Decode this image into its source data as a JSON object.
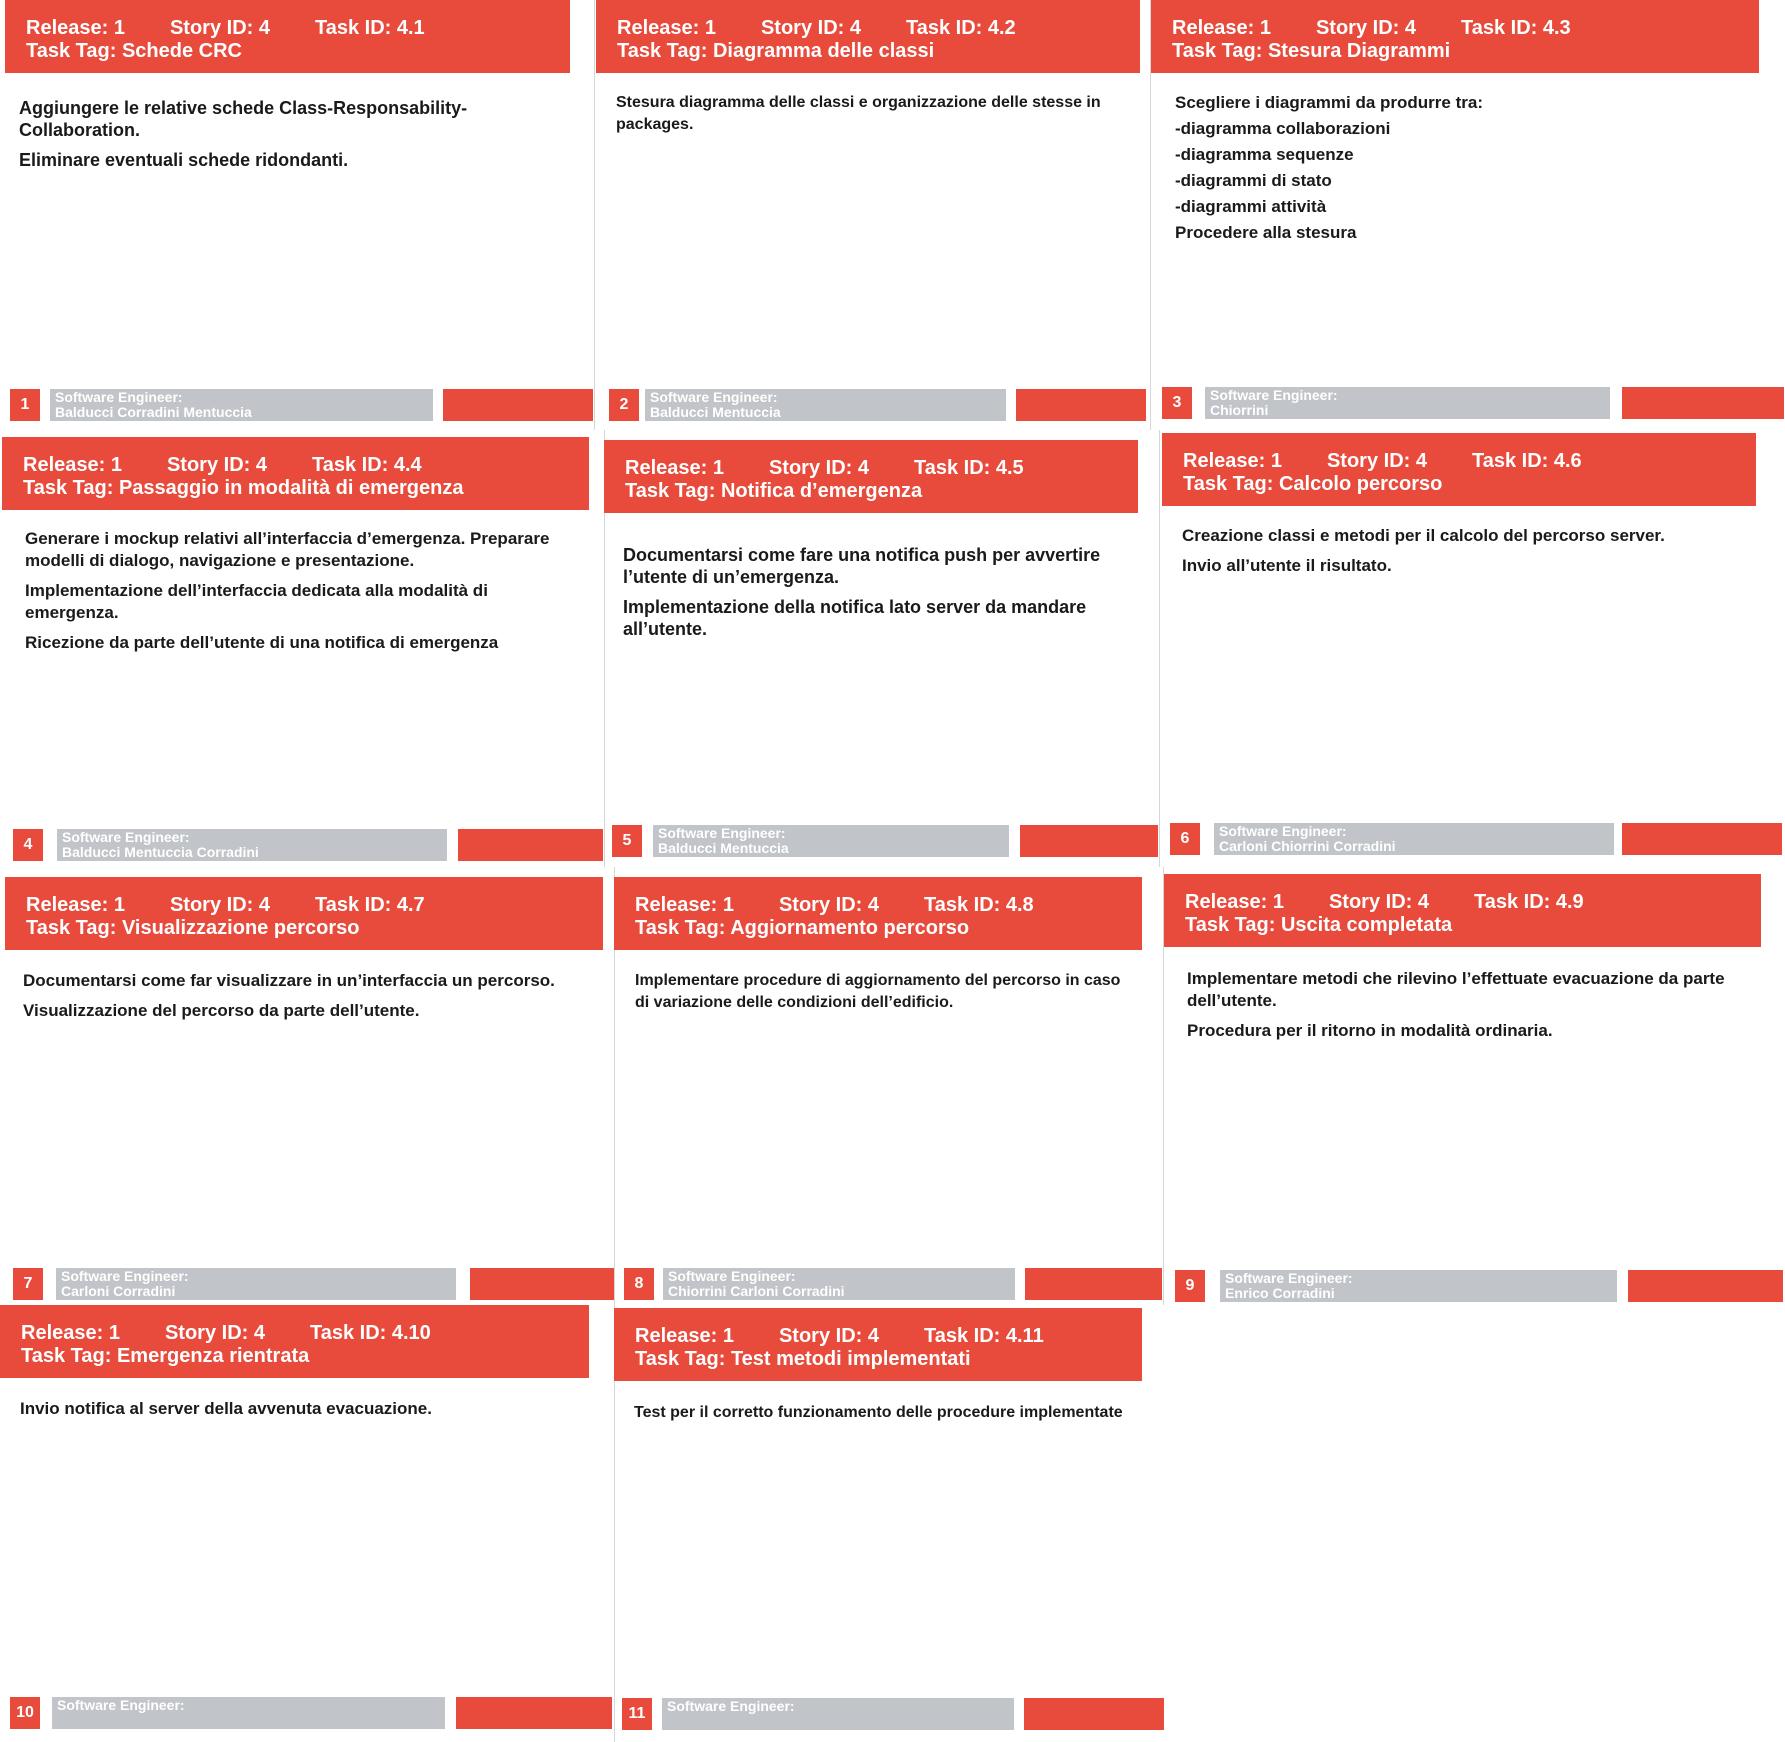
{
  "colors": {
    "accent": "#e84a3c",
    "footer_gray": "#c1c4c8",
    "text": "#1a1a1a"
  },
  "cards": [
    {
      "release": "Release: 1",
      "story": "Story ID: 4",
      "task": "Task ID: 4.1",
      "tag": "Task Tag: Schede CRC",
      "body": [
        "Aggiungere le relative schede Class-Responsability-Collaboration.",
        "Eliminare eventuali schede ridondanti."
      ],
      "number": "1",
      "engineer_label": "Software Engineer:",
      "engineers": "Balducci Corradini Mentuccia"
    },
    {
      "release": "Release: 1",
      "story": "Story ID: 4",
      "task": "Task ID: 4.2",
      "tag": "Task Tag: Diagramma delle classi",
      "body": [
        "Stesura diagramma delle classi e organizzazione delle stesse in packages."
      ],
      "number": "2",
      "engineer_label": "Software Engineer:",
      "engineers": "Balducci Mentuccia"
    },
    {
      "release": "Release: 1",
      "story": "Story ID: 4",
      "task": "Task ID: 4.3",
      "tag": "Task Tag: Stesura Diagrammi",
      "body": [
        "Scegliere i diagrammi da produrre tra:",
        "-diagramma collaborazioni",
        "-diagramma sequenze",
        "-diagrammi di stato",
        "-diagrammi attività",
        "Procedere alla stesura"
      ],
      "number": "3",
      "engineer_label": "Software Engineer:",
      "engineers": "Chiorrini"
    },
    {
      "release": "Release: 1",
      "story": "Story ID: 4",
      "task": "Task ID: 4.4",
      "tag": "Task Tag: Passaggio in modalità di emergenza",
      "body": [
        "Generare i  mockup relativi all’interfaccia d’emergenza. Preparare modelli di dialogo, navigazione e presentazione.",
        "Implementazione dell’interfaccia dedicata alla modalità di emergenza.",
        "Ricezione da parte dell’utente di una notifica di emergenza"
      ],
      "number": "4",
      "engineer_label": "Software Engineer:",
      "engineers": "Balducci Mentuccia Corradini"
    },
    {
      "release": "Release: 1",
      "story": "Story ID: 4",
      "task": "Task ID: 4.5",
      "tag": "Task Tag: Notifica d’emergenza",
      "body": [
        "Documentarsi come fare una notifica push per avvertire l’utente di un’emergenza.",
        "Implementazione della notifica lato server da mandare all’utente."
      ],
      "number": "5",
      "engineer_label": "Software Engineer:",
      "engineers": "Balducci Mentuccia"
    },
    {
      "release": "Release: 1",
      "story": "Story ID: 4",
      "task": "Task ID: 4.6",
      "tag": "Task Tag: Calcolo percorso",
      "body": [
        "Creazione classi e metodi per il calcolo del percorso server.",
        "Invio all’utente il risultato."
      ],
      "number": "6",
      "engineer_label": "Software Engineer:",
      "engineers": "Carloni Chiorrini Corradini"
    },
    {
      "release": "Release: 1",
      "story": "Story ID: 4",
      "task": "Task ID: 4.7",
      "tag": "Task Tag: Visualizzazione percorso",
      "body": [
        "Documentarsi come far visualizzare in un’interfaccia un percorso.",
        "Visualizzazione del percorso da parte dell’utente."
      ],
      "number": "7",
      "engineer_label": "Software Engineer:",
      "engineers": "Carloni Corradini"
    },
    {
      "release": "Release: 1",
      "story": "Story ID: 4",
      "task": "Task ID: 4.8",
      "tag": "Task Tag: Aggiornamento percorso",
      "body": [
        "Implementare procedure di aggiornamento del percorso in caso di variazione delle condizioni dell’edificio."
      ],
      "number": "8",
      "engineer_label": "Software Engineer:",
      "engineers": "Chiorrini Carloni Corradini"
    },
    {
      "release": "Release: 1",
      "story": "Story ID: 4",
      "task": "Task ID: 4.9",
      "tag": "Task Tag: Uscita completata",
      "body": [
        "Implementare metodi che rilevino l’effettuate evacuazione da parte dell’utente.",
        "Procedura per il ritorno in modalità ordinaria."
      ],
      "number": "9",
      "engineer_label": "Software Engineer:",
      "engineers": "Enrico Corradini"
    },
    {
      "release": "Release: 1",
      "story": "Story ID: 4",
      "task": "Task ID: 4.10",
      "tag": "Task Tag: Emergenza rientrata",
      "body": [
        "Invio notifica al server della avvenuta evacuazione."
      ],
      "number": "10",
      "engineer_label": "Software Engineer:",
      "engineers": ""
    },
    {
      "release": "Release: 1",
      "story": "Story ID: 4",
      "task": "Task ID: 4.11",
      "tag": "Task Tag: Test metodi implementati",
      "body": [
        "Test per il corretto funzionamento delle procedure implementate"
      ],
      "number": "11",
      "engineer_label": "Software Engineer:",
      "engineers": ""
    }
  ]
}
